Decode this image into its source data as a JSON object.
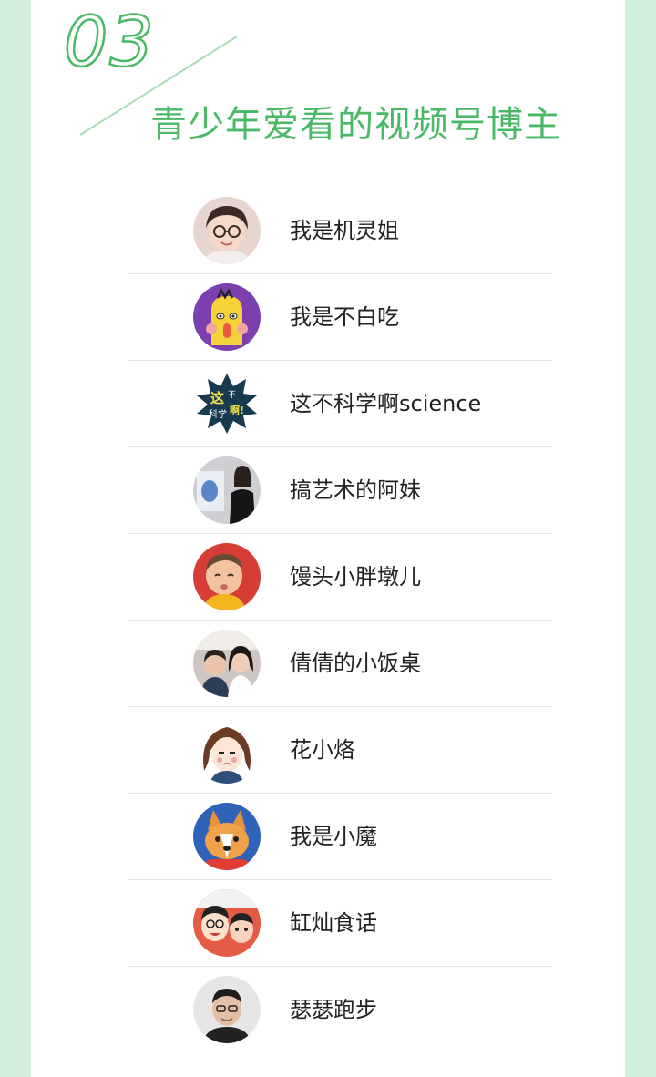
{
  "section": {
    "number": "03",
    "title": "青少年爱看的视频号博主"
  },
  "bloggers": [
    {
      "name": "我是机灵姐",
      "icon": "avatar-girl-glasses-icon"
    },
    {
      "name": "我是不白吃",
      "icon": "avatar-cartoon-purple-icon"
    },
    {
      "name": "这不科学啊science",
      "icon": "avatar-science-badge-icon"
    },
    {
      "name": "搞艺术的阿妹",
      "icon": "avatar-woman-painting-icon"
    },
    {
      "name": "馒头小胖墩儿",
      "icon": "avatar-toddler-icon"
    },
    {
      "name": "倩倩的小饭桌",
      "icon": "avatar-mother-child-icon"
    },
    {
      "name": "花小烙",
      "icon": "avatar-cartoon-girl-icon"
    },
    {
      "name": "我是小魔",
      "icon": "avatar-corgi-icon"
    },
    {
      "name": "缸灿食话",
      "icon": "avatar-two-cartoon-men-icon"
    },
    {
      "name": "瑟瑟跑步",
      "icon": "avatar-man-portrait-icon"
    }
  ],
  "colors": {
    "accent": "#49b966",
    "band": "#d2efd9",
    "divider": "#e4e4e4",
    "text": "#222222"
  },
  "avatar_badge_text": [
    "这",
    "不",
    "科学",
    "啊!"
  ]
}
